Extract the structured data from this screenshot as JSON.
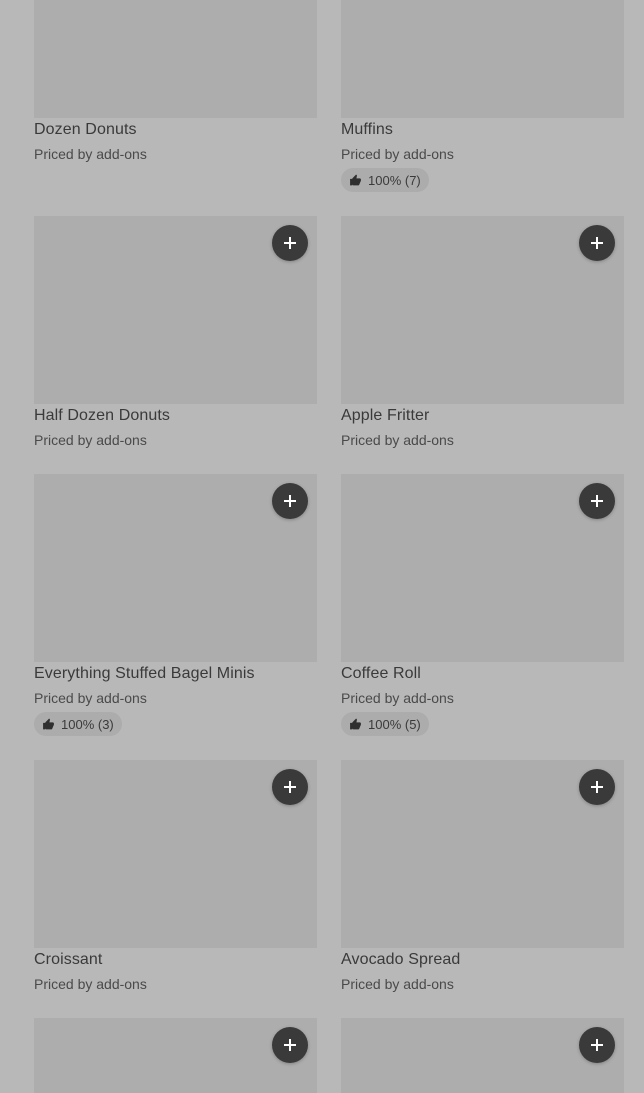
{
  "items": [
    {
      "title": "Dozen Donuts",
      "price": "Priced by add-ons",
      "rating": ""
    },
    {
      "title": "Muffins",
      "price": "Priced by add-ons",
      "rating": "100% (7)"
    },
    {
      "title": "Half Dozen Donuts",
      "price": "Priced by add-ons",
      "rating": ""
    },
    {
      "title": "Apple Fritter",
      "price": "Priced by add-ons",
      "rating": ""
    },
    {
      "title": "Everything Stuffed Bagel Minis",
      "price": "Priced by add-ons",
      "rating": "100% (3)"
    },
    {
      "title": "Coffee Roll",
      "price": "Priced by add-ons",
      "rating": "100% (5)"
    },
    {
      "title": "Croissant",
      "price": "Priced by add-ons",
      "rating": ""
    },
    {
      "title": "Avocado Spread",
      "price": "Priced by add-ons",
      "rating": ""
    }
  ],
  "icons": {
    "add": "plus-icon",
    "rating": "thumbs-up-icon"
  }
}
